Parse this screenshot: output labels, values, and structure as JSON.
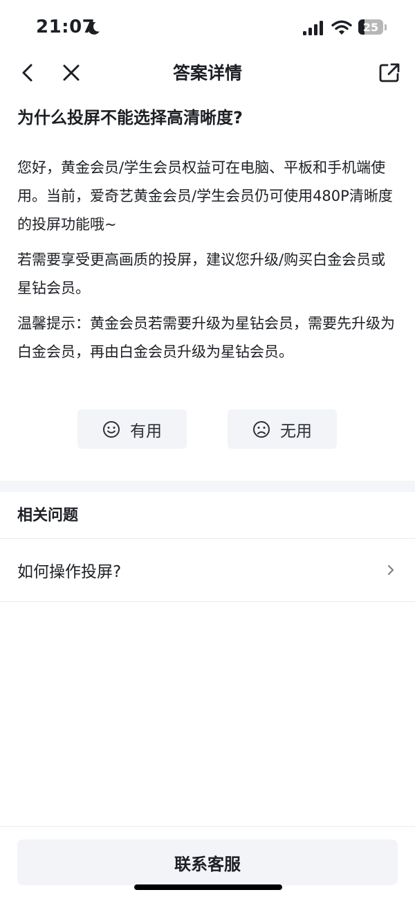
{
  "status_bar": {
    "time": "21:07",
    "battery_level": "25",
    "battery_fraction": 0.25
  },
  "nav": {
    "title": "答案详情"
  },
  "question": {
    "title": "为什么投屏不能选择高清晰度?"
  },
  "answer": {
    "paragraphs": [
      "您好，黄金会员/学生会员权益可在电脑、平板和手机端使用。当前，爱奇艺黄金会员/学生会员仍可使用480P清晰度的投屏功能哦~",
      "若需要享受更高画质的投屏，建议您升级/购买白金会员或星钻会员。",
      "温馨提示：黄金会员若需要升级为星钻会员，需要先升级为白金会员，再由白金会员升级为星钻会员。"
    ]
  },
  "feedback": {
    "useful_label": "有用",
    "useless_label": "无用"
  },
  "related": {
    "header": "相关问题",
    "items": [
      {
        "label": "如何操作投屏?"
      }
    ]
  },
  "bottom": {
    "contact_label": "联系客服"
  },
  "icons": {
    "status": [
      "moon-icon",
      "signal-icon",
      "wifi-icon",
      "battery-icon"
    ],
    "nav": [
      "back-icon",
      "close-icon",
      "share-icon"
    ],
    "feedback": [
      "smile-icon",
      "frown-icon"
    ],
    "related": [
      "chevron-right-icon"
    ]
  }
}
